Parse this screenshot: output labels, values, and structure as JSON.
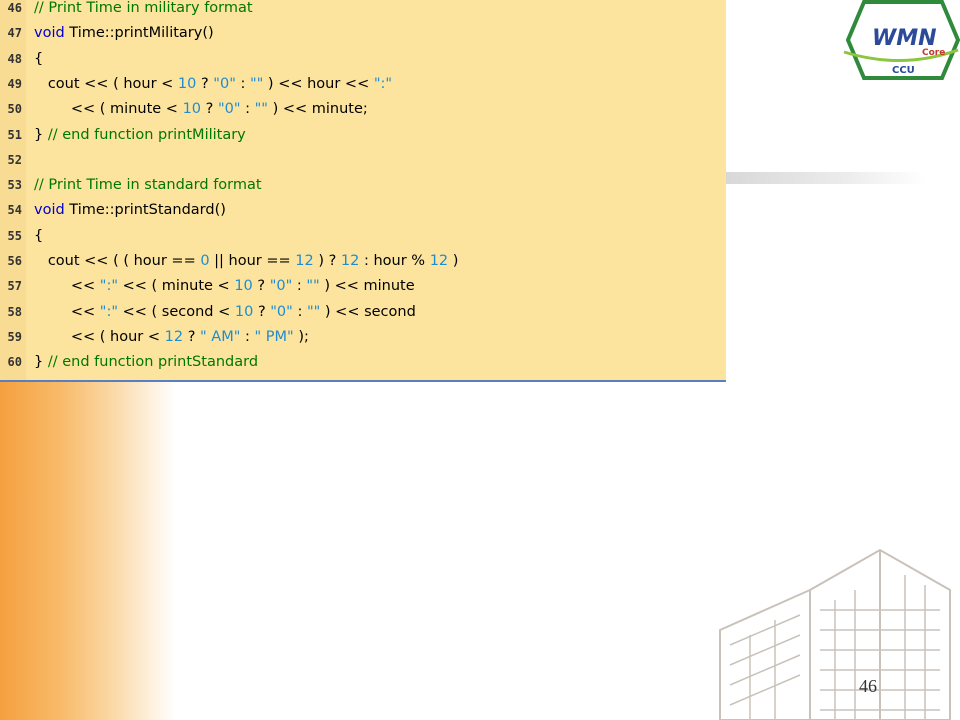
{
  "code_lines": [
    {
      "num": "46",
      "segments": [
        {
          "t": "// Print Time in military format",
          "c": "cm"
        }
      ]
    },
    {
      "num": "47",
      "segments": [
        {
          "t": "void",
          "c": "kw"
        },
        {
          "t": " Time::printMilitary()",
          "c": ""
        }
      ]
    },
    {
      "num": "48",
      "segments": [
        {
          "t": "{",
          "c": ""
        }
      ]
    },
    {
      "num": "49",
      "segments": [
        {
          "t": "   cout << ( hour < ",
          "c": ""
        },
        {
          "t": "10",
          "c": "num"
        },
        {
          "t": " ? ",
          "c": ""
        },
        {
          "t": "\"0\"",
          "c": "str"
        },
        {
          "t": " : ",
          "c": ""
        },
        {
          "t": "\"\"",
          "c": "str"
        },
        {
          "t": " ) << hour << ",
          "c": ""
        },
        {
          "t": "\":\"",
          "c": "str"
        }
      ]
    },
    {
      "num": "50",
      "segments": [
        {
          "t": "        << ( minute < ",
          "c": ""
        },
        {
          "t": "10",
          "c": "num"
        },
        {
          "t": " ? ",
          "c": ""
        },
        {
          "t": "\"0\"",
          "c": "str"
        },
        {
          "t": " : ",
          "c": ""
        },
        {
          "t": "\"\"",
          "c": "str"
        },
        {
          "t": " ) << minute;",
          "c": ""
        }
      ]
    },
    {
      "num": "51",
      "segments": [
        {
          "t": "} ",
          "c": ""
        },
        {
          "t": "// end function printMilitary",
          "c": "cm"
        }
      ]
    },
    {
      "num": "52",
      "segments": []
    },
    {
      "num": "53",
      "segments": [
        {
          "t": "// Print Time in standard format",
          "c": "cm"
        }
      ]
    },
    {
      "num": "54",
      "segments": [
        {
          "t": "void",
          "c": "kw"
        },
        {
          "t": " Time::printStandard()",
          "c": ""
        }
      ]
    },
    {
      "num": "55",
      "segments": [
        {
          "t": "{",
          "c": ""
        }
      ]
    },
    {
      "num": "56",
      "segments": [
        {
          "t": "   cout << ( ( hour == ",
          "c": ""
        },
        {
          "t": "0",
          "c": "num"
        },
        {
          "t": " || hour == ",
          "c": ""
        },
        {
          "t": "12",
          "c": "num"
        },
        {
          "t": " ) ? ",
          "c": ""
        },
        {
          "t": "12",
          "c": "num"
        },
        {
          "t": " : hour % ",
          "c": ""
        },
        {
          "t": "12",
          "c": "num"
        },
        {
          "t": " )",
          "c": ""
        }
      ]
    },
    {
      "num": "57",
      "segments": [
        {
          "t": "        << ",
          "c": ""
        },
        {
          "t": "\":\"",
          "c": "str"
        },
        {
          "t": " << ( minute < ",
          "c": ""
        },
        {
          "t": "10",
          "c": "num"
        },
        {
          "t": " ? ",
          "c": ""
        },
        {
          "t": "\"0\"",
          "c": "str"
        },
        {
          "t": " : ",
          "c": ""
        },
        {
          "t": "\"\"",
          "c": "str"
        },
        {
          "t": " ) << minute",
          "c": ""
        }
      ]
    },
    {
      "num": "58",
      "segments": [
        {
          "t": "        << ",
          "c": ""
        },
        {
          "t": "\":\"",
          "c": "str"
        },
        {
          "t": " << ( second < ",
          "c": ""
        },
        {
          "t": "10",
          "c": "num"
        },
        {
          "t": " ? ",
          "c": ""
        },
        {
          "t": "\"0\"",
          "c": "str"
        },
        {
          "t": " : ",
          "c": ""
        },
        {
          "t": "\"\"",
          "c": "str"
        },
        {
          "t": " ) << second",
          "c": ""
        }
      ]
    },
    {
      "num": "59",
      "segments": [
        {
          "t": "        << ( hour < ",
          "c": ""
        },
        {
          "t": "12",
          "c": "num"
        },
        {
          "t": " ? ",
          "c": ""
        },
        {
          "t": "\" AM\"",
          "c": "str"
        },
        {
          "t": " : ",
          "c": ""
        },
        {
          "t": "\" PM\"",
          "c": "str"
        },
        {
          "t": " );",
          "c": ""
        }
      ]
    },
    {
      "num": "60",
      "segments": [
        {
          "t": "} ",
          "c": ""
        },
        {
          "t": "// end function printStandard",
          "c": "cm"
        }
      ]
    }
  ],
  "logo": {
    "text_main": "WMN",
    "text_small": "CCU",
    "text_side": "Core"
  },
  "page_number": "46",
  "colors": {
    "panel": "#fde49e",
    "keyword": "#0000cc",
    "comment": "#007700",
    "literal": "#1e8cd0",
    "accent": "#f5a040"
  }
}
